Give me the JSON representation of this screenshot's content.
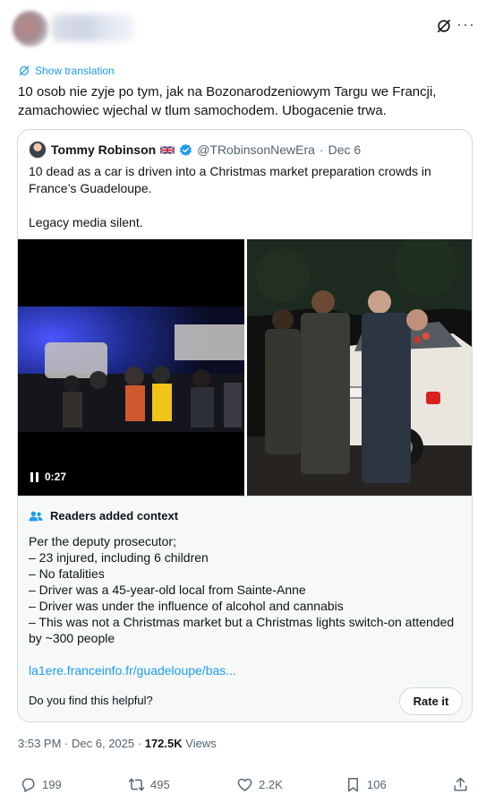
{
  "header": {
    "author_name": "",
    "grok_icon": "grok-icon",
    "more_icon": "more-icon",
    "more_glyph": "···"
  },
  "translation": {
    "label": "Show translation",
    "icon": "translate-icon"
  },
  "tweet": {
    "text": "10 osob nie zyje po tym, jak na Bozonarodzeniowym Targu we Francji, zamachowiec wjechal w tlum samochodem. Ubogacenie trwa."
  },
  "quote": {
    "author": "Tommy Robinson",
    "flag": "uk-flag-icon",
    "handle": "@TRobinsonNewEra",
    "separator": "·",
    "date": "Dec 6",
    "text_line1": "10 dead as a car is driven into a Christmas market preparation crowds in France’s Guadeloupe.",
    "text_line2": "Legacy media silent.",
    "video_time": "0:27"
  },
  "context": {
    "title": "Readers added context",
    "lines": [
      "Per the deputy prosecutor;",
      "– 23 injured, including 6 children",
      "– No fatalities",
      "– Driver was a 45-year-old local from Sainte-Anne",
      "– Driver was under the influence of alcohol and cannabis",
      "– This was not a Christmas market but a Christmas lights switch-on attended by ~300 people"
    ],
    "link": "la1ere.franceinfo.fr/guadeloupe/bas...",
    "question": "Do you find this helpful?",
    "rate_label": "Rate it"
  },
  "meta": {
    "time": "3:53 PM",
    "separator": "·",
    "date": "Dec 6, 2025",
    "views_count": "172.5K",
    "views_label": "Views"
  },
  "actions": {
    "replies": "199",
    "reposts": "495",
    "likes": "2.2K",
    "bookmarks": "106"
  },
  "colors": {
    "accent": "#1d9bf0",
    "text": "#0f1419",
    "muted": "#536471",
    "border": "#cfd9de",
    "context_bg": "#f7f9f9"
  }
}
